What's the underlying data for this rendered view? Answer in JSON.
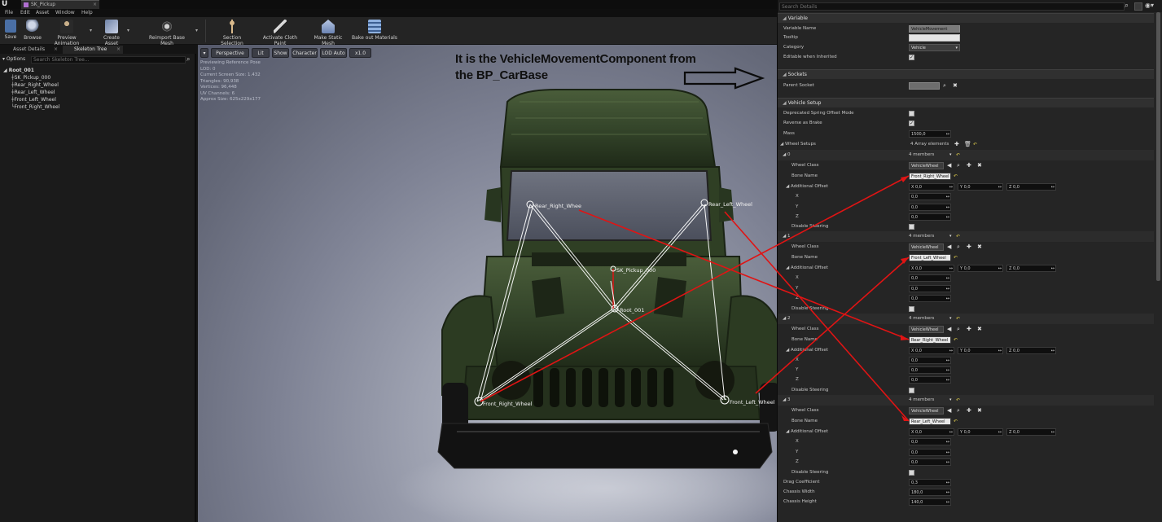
{
  "window": {
    "tab_title": "SK_Pickup",
    "menu": [
      "File",
      "Edit",
      "Asset",
      "Window",
      "Help"
    ]
  },
  "toolbar": {
    "buttons": [
      "Save",
      "Browse",
      "Preview Animation",
      "Create Asset",
      "Reimport Base Mesh",
      "Section Selection",
      "Activate Cloth Paint",
      "Make Static Mesh",
      "Bake out Materials"
    ]
  },
  "left_panel": {
    "tabs": [
      "Asset Details",
      "Skeleton Tree"
    ],
    "options_label": "Options",
    "search_placeholder": "Search Skeleton Tree...",
    "bones": [
      "Root_001",
      "SK_Pickup_000",
      "Rear_Right_Wheel",
      "Rear_Left_Wheel",
      "Front_Left_Wheel",
      "Front_Right_Wheel"
    ]
  },
  "viewport": {
    "buttons": [
      "Perspective",
      "Lit",
      "Show",
      "Character",
      "LOD Auto",
      "x1.0"
    ],
    "info_lines": [
      "Previewing Reference Pose",
      "LOD: 0",
      "Current Screen Size: 1.432",
      "Triangles: 90,938",
      "Vertices: 96,448",
      "UV Channels: 6",
      "Approx Size: 625x229x177"
    ],
    "annotation_lines": [
      "It is the VehicleMovementComponent from",
      "the BP_CarBase"
    ],
    "bone_labels": [
      "Rear_Right_Whee",
      "Rear_Left_Wheel",
      "SK_Pickup_000",
      "Root_001",
      "Front_Right_Wheel",
      "Front_Left_Wheel"
    ]
  },
  "details": {
    "search_placeholder": "Search Details",
    "variable": {
      "header": "Variable",
      "variable_name_label": "Variable Name",
      "variable_name": "VehicleMovement",
      "tooltip_label": "Tooltip",
      "tooltip": "",
      "category_label": "Category",
      "category": "Vehicle",
      "editable_label": "Editable when Inherited",
      "editable": true
    },
    "sockets": {
      "header": "Sockets",
      "parent_socket_label": "Parent Socket",
      "parent_socket": ""
    },
    "vehicle_setup": {
      "header": "Vehicle Setup",
      "deprecated_label": "Deprecated Spring Offset Mode",
      "deprecated": false,
      "reverse_label": "Reverse as Brake",
      "reverse": true,
      "mass_label": "Mass",
      "mass": "1500,0",
      "wheel_setups_label": "Wheel Setups",
      "wheel_setups_count": "4 Array elements",
      "wheels": [
        {
          "index": "0",
          "members": "4 members",
          "wheel_class": "VehicleWheel",
          "bone_name": "Front_Right_Wheel",
          "offset_x": "0,0",
          "offset_y": "0,0",
          "offset_z": "0,0",
          "x": "0,0",
          "y": "0,0",
          "z": "0,0"
        },
        {
          "index": "1",
          "members": "4 members",
          "wheel_class": "VehicleWheel",
          "bone_name": "Front_Left_Wheel",
          "offset_x": "0,0",
          "offset_y": "0,0",
          "offset_z": "0,0",
          "x": "0,0",
          "y": "0,0",
          "z": "0,0"
        },
        {
          "index": "2",
          "members": "4 members",
          "wheel_class": "VehicleWheel",
          "bone_name": "Rear_Right_Wheel",
          "offset_x": "0,0",
          "offset_y": "0,0",
          "offset_z": "0,0",
          "x": "0,0",
          "y": "0,0",
          "z": "0,0"
        },
        {
          "index": "3",
          "members": "4 members",
          "wheel_class": "VehicleWheel",
          "bone_name": "Rear_Left_Wheel",
          "offset_x": "0,0",
          "offset_y": "0,0",
          "offset_z": "0,0",
          "x": "0,0",
          "y": "0,0",
          "z": "0,0"
        }
      ],
      "wheel_class_label": "Wheel Class",
      "bone_name_label": "Bone Name",
      "additional_offset_label": "Additional Offset",
      "disable_steering_label": "Disable Steering",
      "drag_label": "Drag Coefficient",
      "drag": "0,3",
      "chassis_width_label": "Chassis Width",
      "chassis_width": "180,0",
      "chassis_height_label": "Chassis Height",
      "chassis_height": "140,0"
    }
  },
  "colors": {
    "annotation_line": "#e01414",
    "vehicle_body": "#36472a",
    "bone_line": "#ffffff",
    "panel_bg": "#252525"
  }
}
